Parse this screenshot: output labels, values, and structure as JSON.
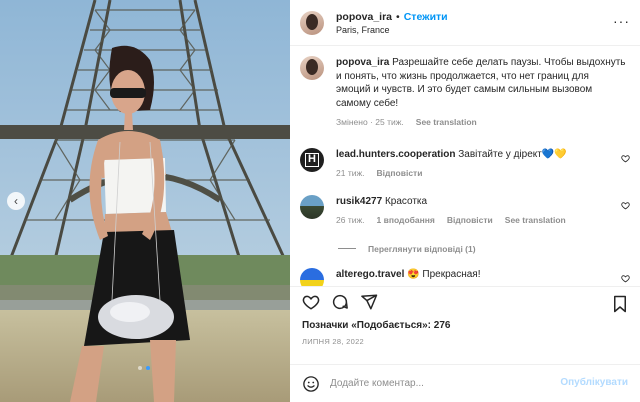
{
  "header": {
    "username": "popova_ira",
    "separator": "•",
    "follow_label": "Стежити",
    "location": "Paris, France",
    "more_icon": "more-horizontal-icon"
  },
  "caption": {
    "username": "popova_ira",
    "text": "Разрешайте себе делать паузы. Чтобы выдохнуть и понять, что жизнь продолжается, что нет границ для эмоций и чувств. И это будет самым сильным вызовом самому себе!",
    "edited": "Змінено · 25 тиж.",
    "translate": "See translation"
  },
  "comments": [
    {
      "username": "lead.hunters.cooperation",
      "text": "Завітайте у дірект💙💛",
      "time": "21 тиж.",
      "likes": "",
      "reply": "Відповісти",
      "translate": ""
    },
    {
      "username": "rusik4277",
      "text": "Красотка",
      "time": "26 тиж.",
      "likes": "1 вподобання",
      "reply": "Відповісти",
      "translate": "See translation"
    },
    {
      "username": "alterego.travel",
      "text": "😍 Прекрасная!",
      "time": "",
      "likes": "",
      "reply": "",
      "translate": ""
    }
  ],
  "view_replies": "Переглянути відповіді (1)",
  "likes_label": "Позначки «Подобається»: 276",
  "date": "ЛИПНЯ 28, 2022",
  "add_comment": {
    "placeholder": "Додайте коментар...",
    "post_label": "Опублікувати"
  },
  "photo": {
    "dots": 2,
    "active_dot": 1
  },
  "colors": {
    "accent": "#0095f6",
    "post_disabled": "#b3dbff",
    "muted": "#8e8e8e"
  }
}
